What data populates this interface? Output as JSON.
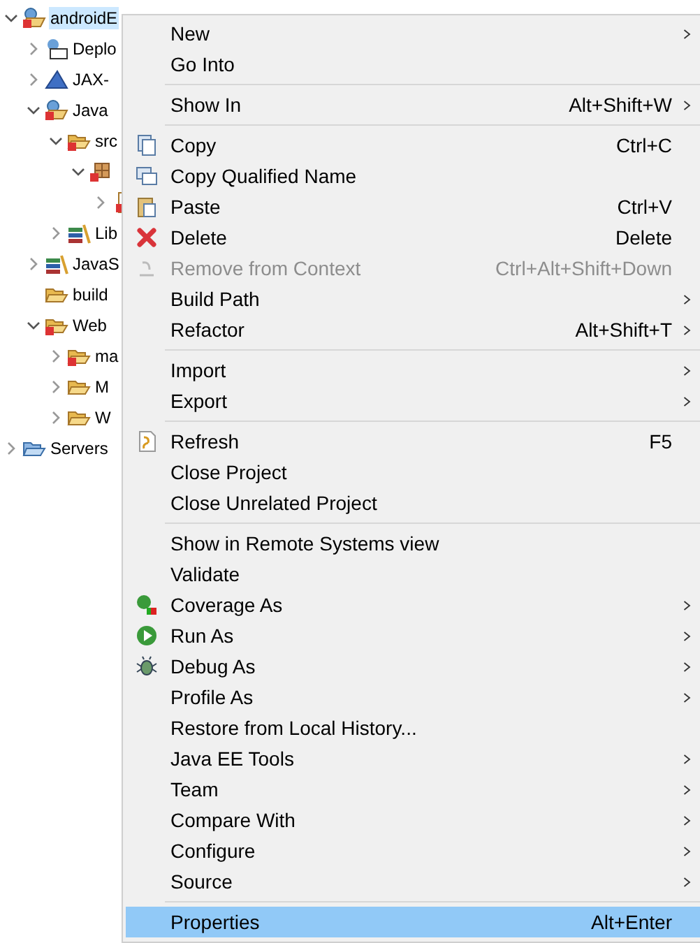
{
  "tree": [
    {
      "label": "androidE",
      "expanded": true,
      "selected": true,
      "children": [
        {
          "label": "Deplo",
          "expanded": false,
          "selected": false
        },
        {
          "label": "JAX-",
          "expanded": false,
          "selected": false
        },
        {
          "label": "Java",
          "expanded": true,
          "selected": false,
          "children": [
            {
              "label": "src",
              "expanded": true,
              "selected": false,
              "children": [
                {
                  "expanded": true,
                  "children": [
                    {
                      "expanded": false
                    }
                  ]
                }
              ]
            },
            {
              "label": "Lib",
              "expanded": false,
              "selected": false
            }
          ]
        },
        {
          "label": "JavaS",
          "expanded": false,
          "selected": false
        },
        {
          "label": "build",
          "selected": false
        },
        {
          "label": "Web",
          "expanded": true,
          "selected": false,
          "children": [
            {
              "label": "ma",
              "expanded": false,
              "selected": false
            },
            {
              "label": "M",
              "expanded": false,
              "selected": false
            },
            {
              "label": "W",
              "expanded": false,
              "selected": false
            }
          ]
        }
      ]
    },
    {
      "label": "Servers",
      "expanded": false,
      "selected": false
    }
  ],
  "context_menu": [
    {
      "kind": "item",
      "label": "New",
      "submenu": true,
      "disabled": false,
      "selected": false
    },
    {
      "kind": "item",
      "label": "Go Into",
      "submenu": false,
      "disabled": false,
      "selected": false
    },
    {
      "kind": "separator"
    },
    {
      "kind": "item",
      "label": "Show In",
      "shortcut": "Alt+Shift+W",
      "submenu": true,
      "disabled": false,
      "selected": false
    },
    {
      "kind": "separator"
    },
    {
      "kind": "item",
      "label": "Copy",
      "shortcut": "Ctrl+C",
      "submenu": false,
      "disabled": false,
      "selected": false
    },
    {
      "kind": "item",
      "label": "Copy Qualified Name",
      "submenu": false,
      "disabled": false,
      "selected": false
    },
    {
      "kind": "item",
      "label": "Paste",
      "shortcut": "Ctrl+V",
      "submenu": false,
      "disabled": false,
      "selected": false
    },
    {
      "kind": "item",
      "label": "Delete",
      "shortcut": "Delete",
      "submenu": false,
      "disabled": false,
      "selected": false
    },
    {
      "kind": "item",
      "label": "Remove from Context",
      "shortcut": "Ctrl+Alt+Shift+Down",
      "submenu": false,
      "disabled": true,
      "selected": false
    },
    {
      "kind": "item",
      "label": "Build Path",
      "submenu": true,
      "disabled": false,
      "selected": false
    },
    {
      "kind": "item",
      "label": "Refactor",
      "shortcut": "Alt+Shift+T",
      "submenu": true,
      "disabled": false,
      "selected": false
    },
    {
      "kind": "separator"
    },
    {
      "kind": "item",
      "label": "Import",
      "submenu": true,
      "disabled": false,
      "selected": false
    },
    {
      "kind": "item",
      "label": "Export",
      "submenu": true,
      "disabled": false,
      "selected": false
    },
    {
      "kind": "separator"
    },
    {
      "kind": "item",
      "label": "Refresh",
      "shortcut": "F5",
      "submenu": false,
      "disabled": false,
      "selected": false
    },
    {
      "kind": "item",
      "label": "Close Project",
      "submenu": false,
      "disabled": false,
      "selected": false
    },
    {
      "kind": "item",
      "label": "Close Unrelated Project",
      "submenu": false,
      "disabled": false,
      "selected": false
    },
    {
      "kind": "separator"
    },
    {
      "kind": "item",
      "label": "Show in Remote Systems view",
      "submenu": false,
      "disabled": false,
      "selected": false
    },
    {
      "kind": "item",
      "label": "Validate",
      "submenu": false,
      "disabled": false,
      "selected": false
    },
    {
      "kind": "item",
      "label": "Coverage As",
      "submenu": true,
      "disabled": false,
      "selected": false
    },
    {
      "kind": "item",
      "label": "Run As",
      "submenu": true,
      "disabled": false,
      "selected": false
    },
    {
      "kind": "item",
      "label": "Debug As",
      "submenu": true,
      "disabled": false,
      "selected": false
    },
    {
      "kind": "item",
      "label": "Profile As",
      "submenu": true,
      "disabled": false,
      "selected": false
    },
    {
      "kind": "item",
      "label": "Restore from Local History...",
      "submenu": false,
      "disabled": false,
      "selected": false
    },
    {
      "kind": "item",
      "label": "Java EE Tools",
      "submenu": true,
      "disabled": false,
      "selected": false
    },
    {
      "kind": "item",
      "label": "Team",
      "submenu": true,
      "disabled": false,
      "selected": false
    },
    {
      "kind": "item",
      "label": "Compare With",
      "submenu": true,
      "disabled": false,
      "selected": false
    },
    {
      "kind": "item",
      "label": "Configure",
      "submenu": true,
      "disabled": false,
      "selected": false
    },
    {
      "kind": "item",
      "label": "Source",
      "submenu": true,
      "disabled": false,
      "selected": false
    },
    {
      "kind": "separator"
    },
    {
      "kind": "item",
      "label": "Properties",
      "shortcut": "Alt+Enter",
      "submenu": false,
      "disabled": false,
      "selected": true
    }
  ]
}
